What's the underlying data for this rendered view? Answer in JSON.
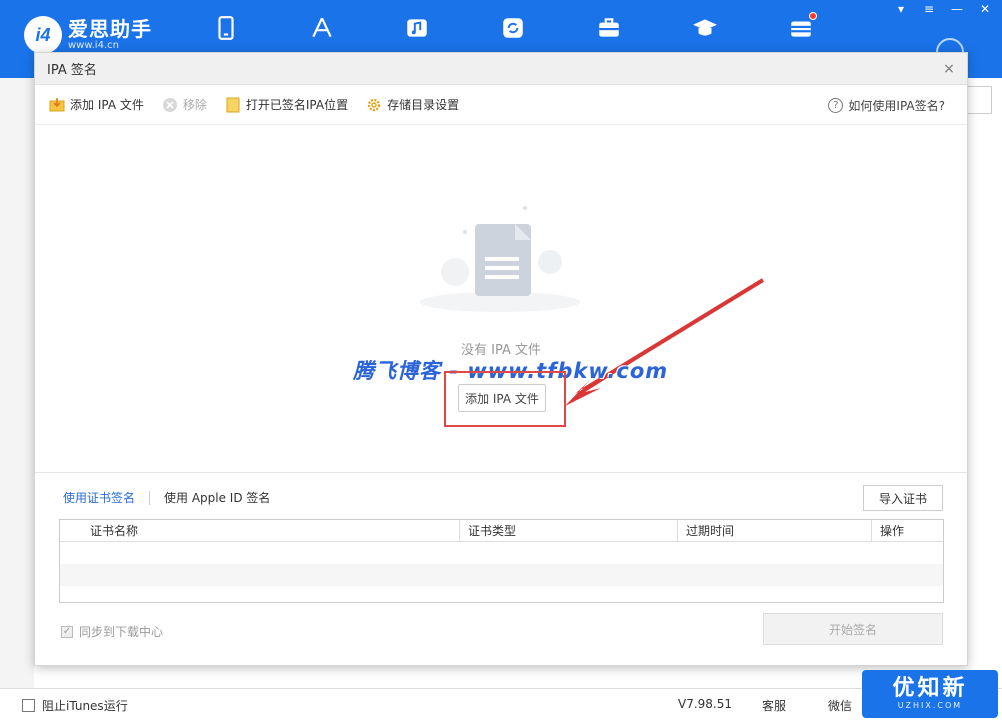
{
  "app": {
    "logo_mark": "i4",
    "name": "爱思助手",
    "site": "www.i4.cn",
    "nav_icons": [
      "phone-icon",
      "appstore-icon",
      "music-icon",
      "sync-icon",
      "toolbox-icon",
      "tutorial-icon",
      "flash-icon"
    ]
  },
  "dialog": {
    "title": "IPA 签名",
    "close": "×",
    "toolbar": {
      "add_file": "添加 IPA 文件",
      "remove": "移除",
      "open_location": "打开已签名IPA位置",
      "storage_settings": "存储目录设置",
      "help": "如何使用IPA签名?"
    },
    "empty": {
      "message": "没有 IPA 文件",
      "add_button": "添加 IPA 文件"
    },
    "watermark": "腾飞博客 - www.tfbkw.com",
    "tabs": {
      "cert_sign": "使用证书签名",
      "appleid_sign": "使用 Apple ID 签名"
    },
    "import_cert": "导入证书",
    "table": {
      "headers": [
        "证书名称",
        "证书类型",
        "过期时间",
        "操作"
      ],
      "rows": []
    },
    "sync_label": "同步到下载中心",
    "start_sign": "开始签名"
  },
  "statusbar": {
    "block_itunes": "阻止iTunes运行",
    "version": "V7.98.51",
    "service": "客服",
    "wechat": "微信"
  },
  "brand_badge": {
    "main": "优知新",
    "sub": "UZHIX.COM"
  },
  "colors": {
    "app_blue": "#1a73e8",
    "tab_active": "#2a6cd6",
    "highlight_red": "#e04848",
    "watermark": "#2b63d9"
  }
}
